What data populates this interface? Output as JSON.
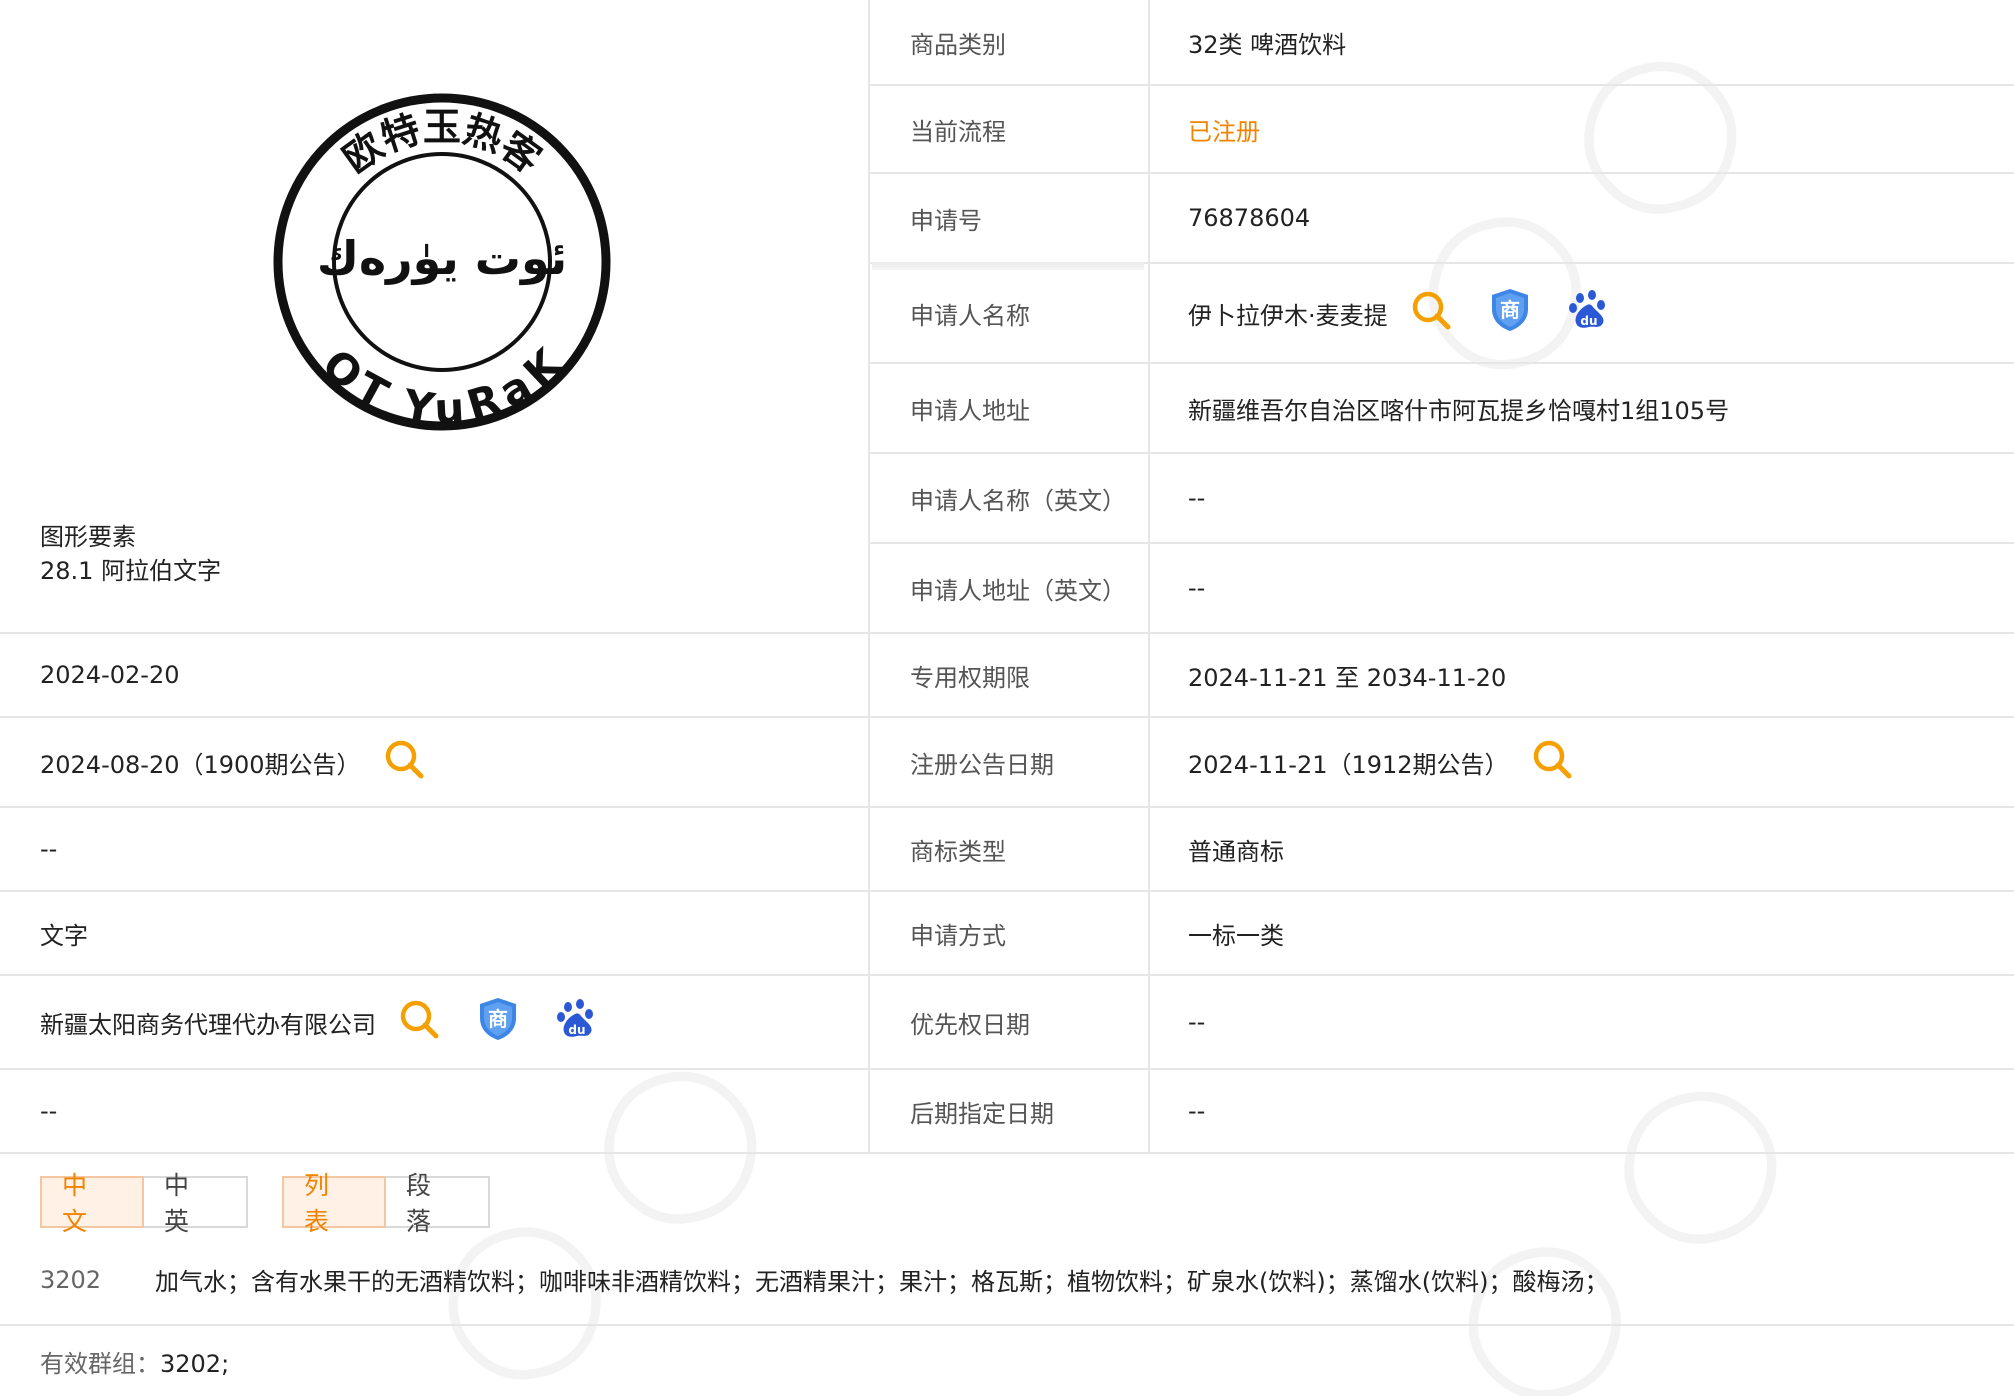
{
  "trademark": {
    "logo_text": {
      "top": "欧特玉热客",
      "middle": "ئوت يۈرەك",
      "bottom": "OT YuRaK"
    },
    "figure_elements_label": "图形要素",
    "figure_elements_value": "28.1 阿拉伯文字"
  },
  "left_rows": [
    {
      "value": "2024-02-20"
    },
    {
      "value": "2024-08-20（1900期公告）"
    },
    {
      "value": "--"
    },
    {
      "value": "文字"
    },
    {
      "value": "新疆太阳商务代理代办有限公司"
    },
    {
      "value": "--"
    }
  ],
  "right_rows": [
    {
      "label": "商品类别",
      "value": "32类 啤酒饮料"
    },
    {
      "label": "当前流程",
      "value": "已注册"
    },
    {
      "label": "申请号",
      "value": "76878604"
    },
    {
      "label": "申请人名称",
      "value": "伊卜拉伊木·麦麦提"
    },
    {
      "label": "申请人地址",
      "value": "新疆维吾尔自治区喀什市阿瓦提乡恰嘎村1组105号"
    },
    {
      "label": "申请人名称（英文）",
      "value": "--"
    },
    {
      "label": "申请人地址（英文）",
      "value": "--"
    },
    {
      "label": "专用权期限",
      "value": "2024-11-21 至 2034-11-20"
    },
    {
      "label": "注册公告日期",
      "value": "2024-11-21（1912期公告）"
    },
    {
      "label": "商标类型",
      "value": "普通商标"
    },
    {
      "label": "申请方式",
      "value": "一标一类"
    },
    {
      "label": "优先权日期",
      "value": "--"
    },
    {
      "label": "后期指定日期",
      "value": "--"
    }
  ],
  "tabs": {
    "lang": [
      "中 文",
      "中 英"
    ],
    "view": [
      "列 表",
      "段 落"
    ]
  },
  "goods": {
    "code": "3202",
    "items": "加气水；含有水果干的无酒精饮料；咖啡味非酒精饮料；无酒精果汁；果汁；格瓦斯；植物饮料；矿泉水(饮料)；蒸馏水(饮料)；酸梅汤；"
  },
  "group": {
    "label": "有效群组：",
    "value": "3202;"
  },
  "colors": {
    "accent": "#f08300",
    "border": "#e6e6e6",
    "shield": "#2f7de1",
    "baidu": "#2b59d6"
  },
  "icons": [
    "search-icon",
    "shield-icon",
    "baidu-paw-icon"
  ]
}
